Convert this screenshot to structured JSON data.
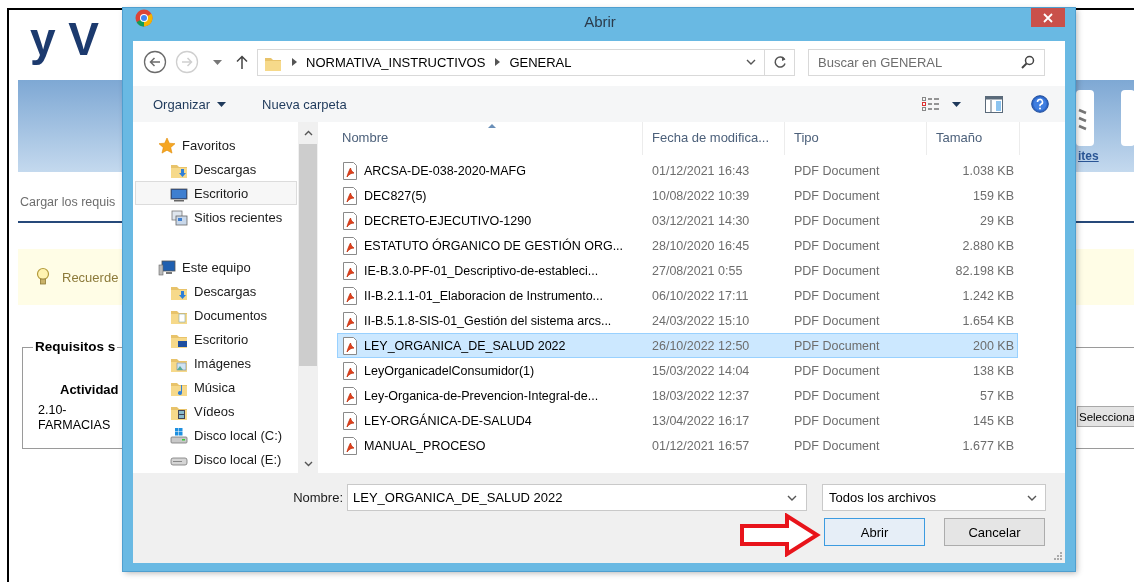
{
  "background_page": {
    "logo_text": "y V",
    "header_link": "ites",
    "section_heading": "Cargar los requis",
    "notice": {
      "text": "Recuerde"
    },
    "fieldset": {
      "legend": "Requisitos s",
      "column_header": "Actividad",
      "cell": "2.10-FARMACIAS",
      "button": "Selecciona"
    }
  },
  "dialog": {
    "title": "Abrir",
    "breadcrumb": [
      "NORMATIVA_INSTRUCTIVOS",
      "GENERAL"
    ],
    "search": {
      "placeholder": "Buscar en GENERAL"
    },
    "toolbar": {
      "organize": "Organizar",
      "new_folder": "Nueva carpeta"
    },
    "nav_pane": [
      {
        "label": "Favoritos",
        "kind": "favorites",
        "selected": false,
        "children": [
          {
            "label": "Descargas",
            "kind": "downloads",
            "selected": false
          },
          {
            "label": "Escritorio",
            "kind": "desktop",
            "selected": true
          },
          {
            "label": "Sitios recientes",
            "kind": "recent",
            "selected": false
          }
        ]
      },
      {
        "label": "Este equipo",
        "kind": "computer",
        "selected": false,
        "children": [
          {
            "label": "Descargas",
            "kind": "downloads",
            "selected": false
          },
          {
            "label": "Documentos",
            "kind": "documents",
            "selected": false
          },
          {
            "label": "Escritorio",
            "kind": "desktop-folder",
            "selected": false
          },
          {
            "label": "Imágenes",
            "kind": "pictures",
            "selected": false
          },
          {
            "label": "Música",
            "kind": "music",
            "selected": false
          },
          {
            "label": "Vídeos",
            "kind": "videos",
            "selected": false
          },
          {
            "label": "Disco local (C:)",
            "kind": "system-drive",
            "selected": false
          },
          {
            "label": "Disco local (E:)",
            "kind": "drive",
            "selected": false
          }
        ]
      }
    ],
    "columns": [
      {
        "label": "Nombre",
        "sorted": true
      },
      {
        "label": "Fecha de modifica...",
        "sorted": false
      },
      {
        "label": "Tipo",
        "sorted": false
      },
      {
        "label": "Tamaño",
        "sorted": false
      }
    ],
    "files": [
      {
        "name": "ARCSA-DE-038-2020-MAFG",
        "date": "01/12/2021 16:43",
        "type": "PDF Document",
        "size": "1.038 KB",
        "selected": false
      },
      {
        "name": "DEC827(5)",
        "date": "10/08/2022 10:39",
        "type": "PDF Document",
        "size": "159 KB",
        "selected": false
      },
      {
        "name": "DECRETO-EJECUTIVO-1290",
        "date": "03/12/2021 14:30",
        "type": "PDF Document",
        "size": "29 KB",
        "selected": false
      },
      {
        "name": "ESTATUTO ÓRGANICO DE GESTIÓN ORG...",
        "date": "28/10/2020 16:45",
        "type": "PDF Document",
        "size": "2.880 KB",
        "selected": false
      },
      {
        "name": "IE-B.3.0-PF-01_Descriptivo-de-estableci...",
        "date": "27/08/2021 0:55",
        "type": "PDF Document",
        "size": "82.198 KB",
        "selected": false
      },
      {
        "name": "II-B.2.1.1-01_Elaboracion de Instrumento...",
        "date": "06/10/2022 17:11",
        "type": "PDF Document",
        "size": "1.242 KB",
        "selected": false
      },
      {
        "name": "II-B.5.1.8-SIS-01_Gestión del sistema arcs...",
        "date": "24/03/2022 15:10",
        "type": "PDF Document",
        "size": "1.654 KB",
        "selected": false
      },
      {
        "name": "LEY_ORGANICA_DE_SALUD 2022",
        "date": "26/10/2022 12:50",
        "type": "PDF Document",
        "size": "200 KB",
        "selected": true
      },
      {
        "name": "LeyOrganicadelConsumidor(1)",
        "date": "15/03/2022 14:04",
        "type": "PDF Document",
        "size": "138 KB",
        "selected": false
      },
      {
        "name": "Ley-Organica-de-Prevencion-Integral-de...",
        "date": "18/03/2022 12:37",
        "type": "PDF Document",
        "size": "57 KB",
        "selected": false
      },
      {
        "name": "LEY-ORGÁNICA-DE-SALUD4",
        "date": "13/04/2022 16:17",
        "type": "PDF Document",
        "size": "145 KB",
        "selected": false
      },
      {
        "name": "MANUAL_PROCESO",
        "date": "01/12/2021 16:57",
        "type": "PDF Document",
        "size": "1.677 KB",
        "selected": false
      }
    ],
    "file_name": {
      "label": "Nombre:",
      "value": "LEY_ORGANICA_DE_SALUD 2022"
    },
    "filter": "Todos los archivos",
    "buttons": [
      {
        "label": "Abrir",
        "kind": "default"
      },
      {
        "label": "Cancelar",
        "kind": "normal"
      }
    ]
  }
}
